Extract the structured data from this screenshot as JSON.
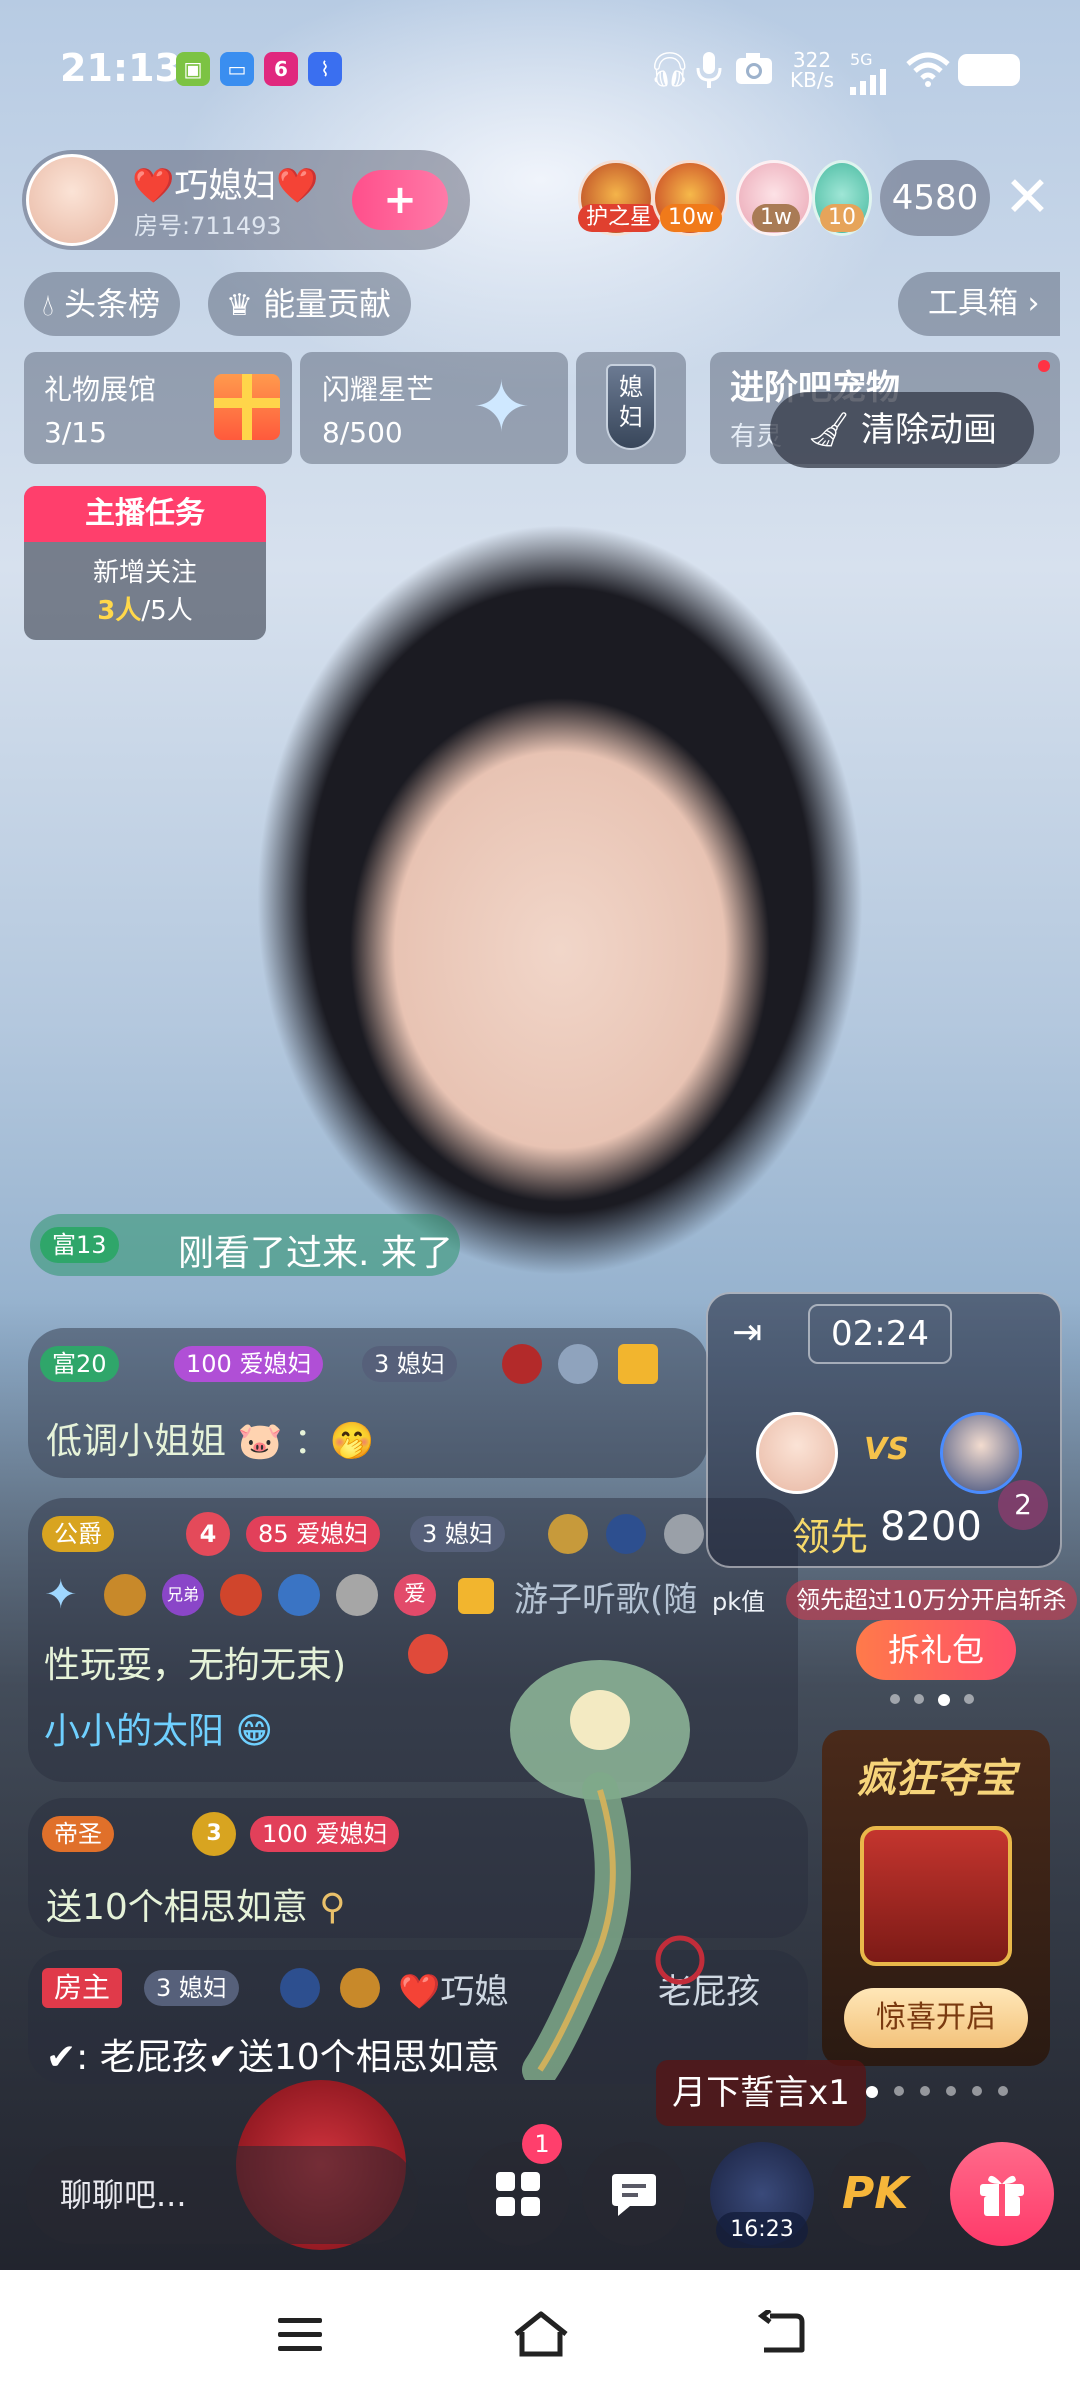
{
  "status_bar": {
    "time": "21:13",
    "net_speed_value": "322",
    "net_speed_unit": "KB/s",
    "signal_type": "5G",
    "app_icons": [
      "app-icon-green",
      "app-icon-blue",
      "app-icon-6room",
      "app-icon-link"
    ],
    "right_icons": [
      "headphones-icon",
      "microphone-icon",
      "camera-icon",
      "signal-icon",
      "wifi-icon",
      "battery-icon"
    ]
  },
  "host": {
    "name": "❤️巧媳妇❤️",
    "room_label": "房号:711493",
    "follow_symbol": "+"
  },
  "top_viewers": [
    {
      "badge": "护之星",
      "color": "#e0402f"
    },
    {
      "badge": "10w",
      "color": "#f07a1a"
    },
    {
      "badge": "1w",
      "color": "#a97b55"
    },
    {
      "badge": "10",
      "color": "#e6a45a"
    }
  ],
  "viewer_count": "4580",
  "close_symbol": "✕",
  "pills": {
    "headline": "头条榜",
    "energy": "能量贡献",
    "toolbox": "工具箱",
    "toolbox_arrow": "›"
  },
  "tiles": {
    "gift_hall_label": "礼物展馆",
    "gift_hall_value": "3/15",
    "star_label": "闪耀星芒",
    "star_value": "8/500",
    "badge_char_1": "媳",
    "badge_char_2": "妇",
    "pet_label": "进阶吧宠物",
    "pet_sub": "有灵",
    "clear_anim": "清除动画"
  },
  "task": {
    "header": "主播任务",
    "title": "新增关注",
    "progress_done": "3人",
    "progress_total": "/5人"
  },
  "chat": {
    "m1_level": "富13",
    "m1_text": "刚看了过来. 来了",
    "m2_level": "富20",
    "m2_fan_level": "100",
    "m2_fan_name": "爱媳妇",
    "m2_tag_level": "3",
    "m2_tag_name": "媳妇",
    "m2_text": "低调小姐姐",
    "m2_colon": "：",
    "m3_rank": "公爵",
    "m3_level": "4",
    "m3_fan_level": "85",
    "m3_fan_name": "爱媳妇",
    "m3_tag_level": "3",
    "m3_tag_name": "媳妇",
    "m3_medal_text": "兄弟",
    "m3_love": "爱",
    "m3_user": "游子听歌(随",
    "m3_text": "性玩耍，无拘无束)",
    "m4_user": "小小的太阳",
    "m5_rank": "帝圣",
    "m5_level": "3",
    "m5_fan_level": "100",
    "m5_fan_name": "爱媳妇",
    "m5_text": "送10个相思如意",
    "m6_role": "房主",
    "m6_tag_level": "3",
    "m6_tag_name": "媳妇",
    "m6_name_left": "❤️巧媳",
    "m6_name_right": "老屁孩",
    "m6_text": "✔: 老屁孩✔送10个相思如意"
  },
  "pk": {
    "timer": "02:24",
    "vs": "VS",
    "lead_label": "领先",
    "lead_value": "8200",
    "pk_value_label": "pk值",
    "rule_text": "领先超过10万分开启斩杀",
    "right_badge": "2",
    "gift_pack": "拆礼包"
  },
  "treasure": {
    "title": "疯狂夺宝",
    "button": "惊喜开启"
  },
  "gift_toast": "月下誓言x1",
  "bottom": {
    "chat_placeholder": "聊聊吧...",
    "more_badge": "1",
    "avatar_timer": "16:23",
    "pk_label": "PK"
  },
  "nav": {
    "menu_icon": "menu-icon",
    "home_icon": "home-icon",
    "back_icon": "back-icon"
  }
}
